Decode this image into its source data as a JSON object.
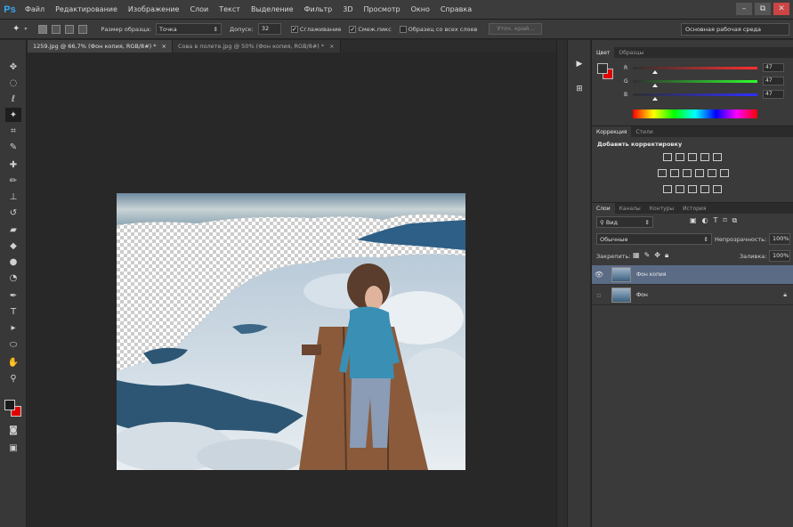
{
  "app": {
    "logo": "Ps"
  },
  "menu": [
    "Файл",
    "Редактирование",
    "Изображение",
    "Слои",
    "Текст",
    "Выделение",
    "Фильтр",
    "3D",
    "Просмотр",
    "Окно",
    "Справка"
  ],
  "window_controls": {
    "minimize": "–",
    "maximize": "⧉",
    "close": "✕"
  },
  "options": {
    "sample_size_label": "Размер образца:",
    "sample_size_value": "Точка",
    "tolerance_label": "Допуск:",
    "tolerance_value": "32",
    "antialias_label": "Сглаживание",
    "contiguous_label": "Смеж.пикс",
    "sample_all_label": "Образец со всех слоев",
    "refine_edge_label": "Уточ. край...",
    "workspace": "Основная рабочая среда"
  },
  "tabs": [
    {
      "label": "1259.jpg @ 66,7% (Фон копия, RGB/8#) *",
      "close": "×"
    },
    {
      "label": "Сова в полете.jpg @ 50% (Фон копия, RGB/8#) *",
      "close": "×"
    }
  ],
  "color_panel": {
    "tabs": [
      "Цвет",
      "Образцы"
    ],
    "channels": [
      {
        "name": "R",
        "value": "47",
        "fraction": 0.18
      },
      {
        "name": "G",
        "value": "47",
        "fraction": 0.18
      },
      {
        "name": "B",
        "value": "47",
        "fraction": 0.18
      }
    ],
    "fg_color": "#2f2f2f",
    "bg_color": "#e00000"
  },
  "adjustments_panel": {
    "tabs": [
      "Коррекция",
      "Стили"
    ],
    "title": "Добавить корректировку"
  },
  "layers_panel": {
    "tabs": [
      "Слои",
      "Каналы",
      "Контуры",
      "История"
    ],
    "filter_label": "Вид",
    "blend_mode": "Обычные",
    "opacity_label": "Непрозрачность:",
    "opacity_value": "100%",
    "lock_label": "Закрепить:",
    "fill_label": "Заливка:",
    "fill_value": "100%",
    "layers": [
      {
        "name": "Фон копия",
        "selected": true
      },
      {
        "name": "Фон",
        "selected": false
      }
    ]
  }
}
